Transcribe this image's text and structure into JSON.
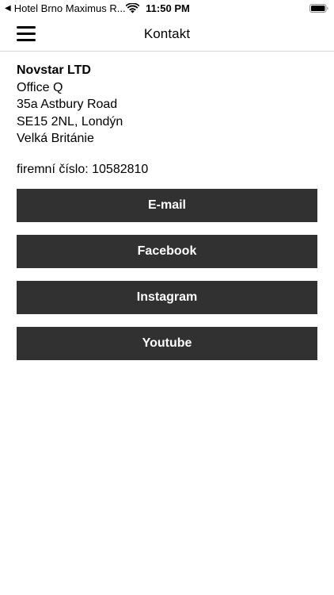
{
  "status_bar": {
    "back_label": "Hotel Brno Maximus R...",
    "time": "11:50 PM"
  },
  "nav": {
    "title": "Kontakt"
  },
  "contact": {
    "company": "Novstar LTD",
    "address_lines": [
      "Office Q",
      "35a Astbury Road",
      "SE15 2NL, Londýn",
      "Velká Británie"
    ],
    "company_id": "firemní číslo: 10582810"
  },
  "links": [
    {
      "label": "E-mail"
    },
    {
      "label": "Facebook"
    },
    {
      "label": "Instagram"
    },
    {
      "label": "Youtube"
    }
  ]
}
